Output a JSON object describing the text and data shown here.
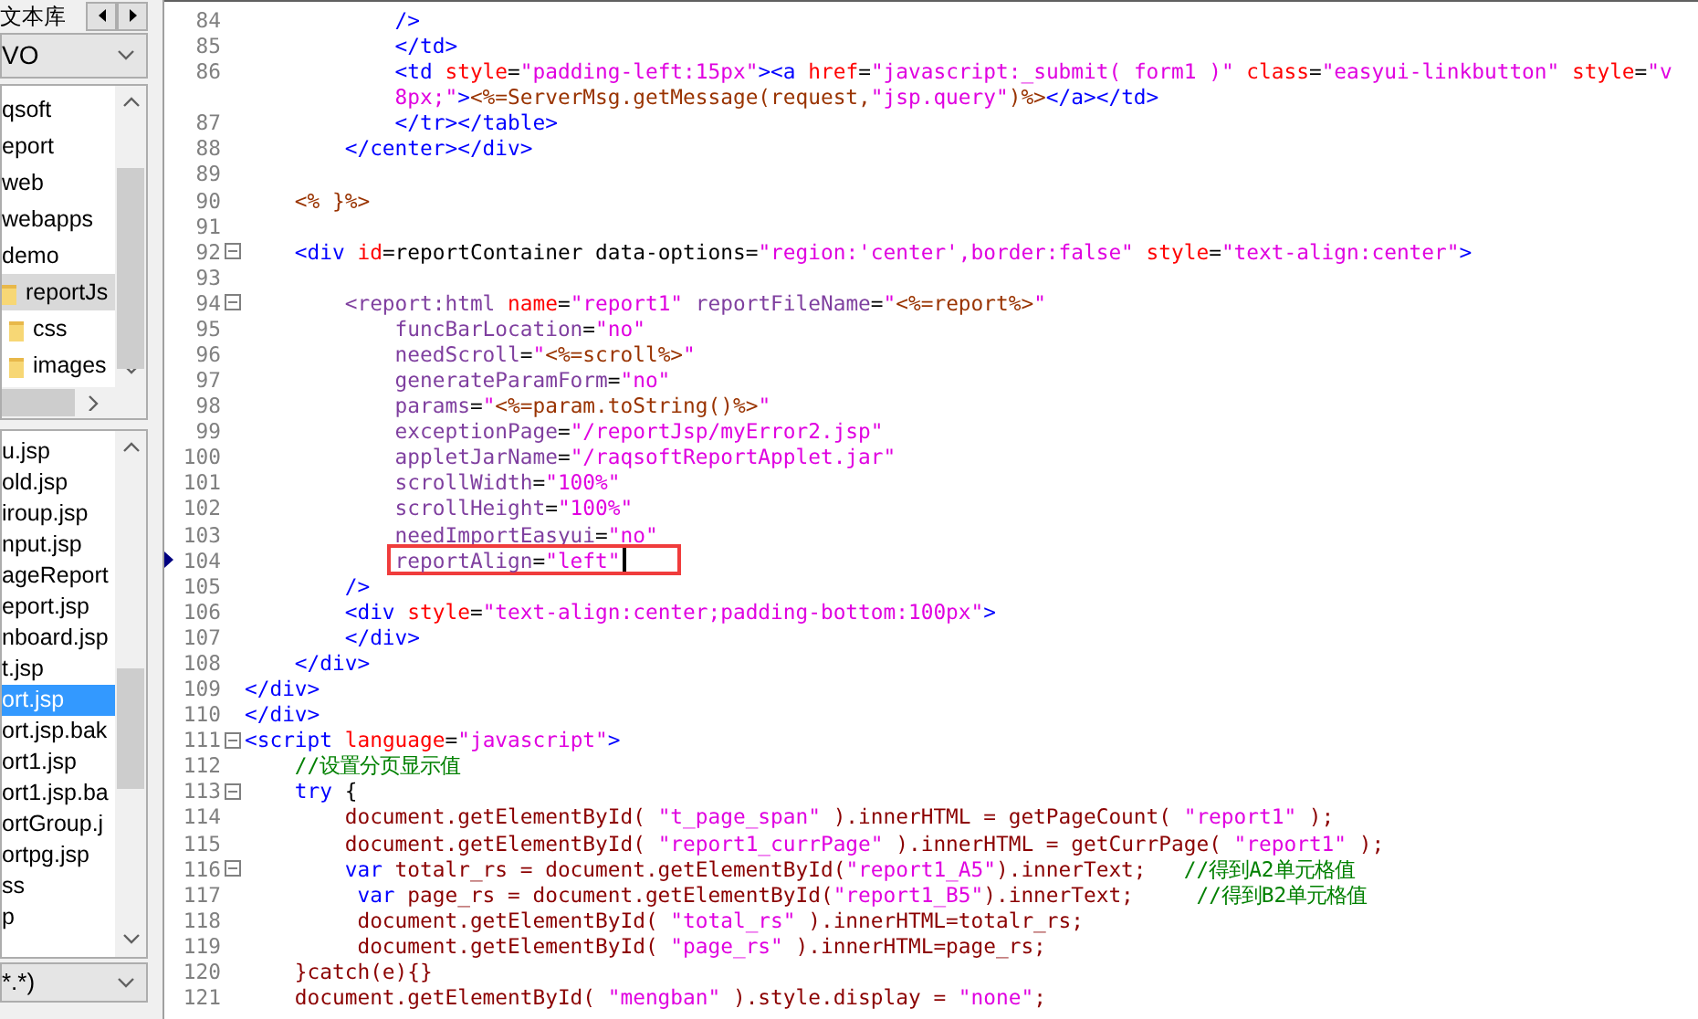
{
  "side_panel": {
    "tab_label": "文本库",
    "drive": "VO",
    "folders": [
      {
        "label": "qsoft",
        "kind": "plain",
        "selected": false
      },
      {
        "label": "eport",
        "kind": "plain",
        "selected": false
      },
      {
        "label": "web",
        "kind": "plain",
        "selected": false
      },
      {
        "label": "webapps",
        "kind": "plain",
        "selected": false
      },
      {
        "label": "demo",
        "kind": "plain",
        "selected": false
      },
      {
        "label": "reportJs",
        "kind": "folder",
        "selected": true,
        "children": [
          {
            "label": "css",
            "kind": "folder",
            "selected": false
          },
          {
            "label": "images",
            "kind": "folder",
            "selected": false
          }
        ]
      }
    ],
    "files": [
      {
        "label": "u.jsp",
        "selected": false
      },
      {
        "label": "old.jsp",
        "selected": false
      },
      {
        "label": "iroup.jsp",
        "selected": false
      },
      {
        "label": "nput.jsp",
        "selected": false
      },
      {
        "label": "ageReport",
        "selected": false
      },
      {
        "label": "eport.jsp",
        "selected": false
      },
      {
        "label": "nboard.jsp",
        "selected": false
      },
      {
        "label": "t.jsp",
        "selected": false
      },
      {
        "label": "ort.jsp",
        "selected": true
      },
      {
        "label": "ort.jsp.bak",
        "selected": false
      },
      {
        "label": "ort1.jsp",
        "selected": false
      },
      {
        "label": "ort1.jsp.ba",
        "selected": false
      },
      {
        "label": "ortGroup.j",
        "selected": false
      },
      {
        "label": "ortpg.jsp",
        "selected": false
      },
      {
        "label": "ss",
        "selected": false
      },
      {
        "label": "p",
        "selected": false
      }
    ],
    "filter": "*.*)"
  },
  "editor": {
    "lines": [
      {
        "number": "84",
        "fold": false,
        "segments": [
          {
            "kind": "tag",
            "text": "            />"
          }
        ]
      },
      {
        "number": "85",
        "fold": false,
        "segments": [
          {
            "kind": "tag",
            "text": "            </td>"
          }
        ]
      },
      {
        "number": "86",
        "fold": false,
        "segments": [
          {
            "kind": "tag",
            "text": "            <td"
          },
          {
            "kind": "attr",
            "text": " style"
          },
          {
            "kind": "plain",
            "text": "="
          },
          {
            "kind": "str",
            "text": "\"padding-left:15px\""
          },
          {
            "kind": "tag",
            "text": "><a"
          },
          {
            "kind": "attr",
            "text": " href"
          },
          {
            "kind": "plain",
            "text": "="
          },
          {
            "kind": "str",
            "text": "\"javascript:_submit( form1 )\""
          },
          {
            "kind": "attr",
            "text": " class"
          },
          {
            "kind": "plain",
            "text": "="
          },
          {
            "kind": "str",
            "text": "\"easyui-linkbutton\""
          },
          {
            "kind": "attr",
            "text": " style"
          },
          {
            "kind": "plain",
            "text": "="
          },
          {
            "kind": "str",
            "text": "\"v"
          }
        ]
      },
      {
        "fold": false,
        "segments": [
          {
            "kind": "str",
            "text": "            8px;\""
          },
          {
            "kind": "tag",
            "text": ">"
          },
          {
            "kind": "jsp",
            "text": "<%=ServerMsg.getMessage(request,"
          },
          {
            "kind": "str",
            "text": "\"jsp.query\""
          },
          {
            "kind": "jsp",
            "text": ")%>"
          },
          {
            "kind": "tag",
            "text": "</a></td>"
          }
        ]
      },
      {
        "number": "87",
        "fold": false,
        "segments": [
          {
            "kind": "tag",
            "text": "            </tr></table>"
          }
        ]
      },
      {
        "number": "88",
        "fold": false,
        "segments": [
          {
            "kind": "tag",
            "text": "        </center></div>"
          }
        ]
      },
      {
        "number": "89",
        "fold": false
      },
      {
        "number": "90",
        "fold": false,
        "segments": [
          {
            "kind": "jsp",
            "text": "    <% }%>"
          }
        ]
      },
      {
        "number": "91",
        "fold": false
      },
      {
        "number": "92",
        "fold": true,
        "segments": [
          {
            "kind": "tag",
            "text": "    <div"
          },
          {
            "kind": "attr",
            "text": " id"
          },
          {
            "kind": "plain",
            "text": "=reportContainer data-options="
          },
          {
            "kind": "str",
            "text": "\"region:'center',border:false\""
          },
          {
            "kind": "attr",
            "text": " style"
          },
          {
            "kind": "plain",
            "text": "="
          },
          {
            "kind": "str",
            "text": "\"text-align:center\""
          },
          {
            "kind": "tag",
            "text": ">"
          }
        ]
      },
      {
        "number": "93",
        "fold": false
      },
      {
        "number": "94",
        "fold": true,
        "segments": [
          {
            "kind": "ctag",
            "text": "        <report:html"
          },
          {
            "kind": "attr",
            "text": " name"
          },
          {
            "kind": "plain",
            "text": "="
          },
          {
            "kind": "str",
            "text": "\"report1\""
          },
          {
            "kind": "cattr",
            "text": " reportFileName"
          },
          {
            "kind": "plain",
            "text": "="
          },
          {
            "kind": "str",
            "text": "\""
          },
          {
            "kind": "jsp",
            "text": "<%=report%>"
          },
          {
            "kind": "str",
            "text": "\""
          }
        ]
      },
      {
        "number": "95",
        "fold": false,
        "segments": [
          {
            "kind": "cattr",
            "text": "            funcBarLocation"
          },
          {
            "kind": "plain",
            "text": "="
          },
          {
            "kind": "str",
            "text": "\"no\""
          }
        ]
      },
      {
        "number": "96",
        "fold": false,
        "segments": [
          {
            "kind": "cattr",
            "text": "            needScroll"
          },
          {
            "kind": "plain",
            "text": "="
          },
          {
            "kind": "str",
            "text": "\""
          },
          {
            "kind": "jsp",
            "text": "<%=scroll%>"
          },
          {
            "kind": "str",
            "text": "\""
          }
        ]
      },
      {
        "number": "97",
        "fold": false,
        "segments": [
          {
            "kind": "cattr",
            "text": "            generateParamForm"
          },
          {
            "kind": "plain",
            "text": "="
          },
          {
            "kind": "str",
            "text": "\"no\""
          }
        ]
      },
      {
        "number": "98",
        "fold": false,
        "segments": [
          {
            "kind": "cattr",
            "text": "            params"
          },
          {
            "kind": "plain",
            "text": "="
          },
          {
            "kind": "str",
            "text": "\""
          },
          {
            "kind": "jsp",
            "text": "<%=param.toString()%>"
          },
          {
            "kind": "str",
            "text": "\""
          }
        ]
      },
      {
        "number": "99",
        "fold": false,
        "segments": [
          {
            "kind": "cattr",
            "text": "            exceptionPage"
          },
          {
            "kind": "plain",
            "text": "="
          },
          {
            "kind": "str",
            "text": "\"/reportJsp/myError2.jsp\""
          }
        ]
      },
      {
        "number": "100",
        "fold": false,
        "segments": [
          {
            "kind": "cattr",
            "text": "            appletJarName"
          },
          {
            "kind": "plain",
            "text": "="
          },
          {
            "kind": "str",
            "text": "\"/raqsoftReportApplet.jar\""
          }
        ]
      },
      {
        "number": "101",
        "fold": false,
        "segments": [
          {
            "kind": "cattr",
            "text": "            scrollWidth"
          },
          {
            "kind": "plain",
            "text": "="
          },
          {
            "kind": "str",
            "text": "\"100%\""
          }
        ]
      },
      {
        "number": "102",
        "fold": false,
        "segments": [
          {
            "kind": "cattr",
            "text": "            scrollHeight"
          },
          {
            "kind": "plain",
            "text": "="
          },
          {
            "kind": "str",
            "text": "\"100%\""
          }
        ]
      },
      {
        "number": "103",
        "fold": false,
        "segments": [
          {
            "kind": "cattr",
            "text": "            needImportEasyui"
          },
          {
            "kind": "plain",
            "text": "="
          },
          {
            "kind": "str",
            "text": "\"no\""
          }
        ]
      },
      {
        "number": "104",
        "fold": false,
        "current": true,
        "highlight": true,
        "segments": [
          {
            "kind": "cattr",
            "text": "            reportAlign"
          },
          {
            "kind": "plain",
            "text": "="
          },
          {
            "kind": "str",
            "text": "\"left\""
          }
        ]
      },
      {
        "number": "105",
        "fold": false,
        "segments": [
          {
            "kind": "tag",
            "text": "        />"
          }
        ]
      },
      {
        "number": "106",
        "fold": false,
        "segments": [
          {
            "kind": "tag",
            "text": "        <div"
          },
          {
            "kind": "attr",
            "text": " style"
          },
          {
            "kind": "plain",
            "text": "="
          },
          {
            "kind": "str",
            "text": "\"text-align:center;padding-bottom:100px\""
          },
          {
            "kind": "tag",
            "text": ">"
          }
        ]
      },
      {
        "number": "107",
        "fold": false,
        "segments": [
          {
            "kind": "tag",
            "text": "        </div>"
          }
        ]
      },
      {
        "number": "108",
        "fold": false,
        "segments": [
          {
            "kind": "tag",
            "text": "    </div>"
          }
        ]
      },
      {
        "number": "109",
        "fold": false,
        "segments": [
          {
            "kind": "tag",
            "text": "</div>"
          }
        ]
      },
      {
        "number": "110",
        "fold": false,
        "segments": [
          {
            "kind": "tag",
            "text": "</div>"
          }
        ]
      },
      {
        "number": "111",
        "fold": true,
        "segments": [
          {
            "kind": "tag",
            "text": "<script"
          },
          {
            "kind": "attr",
            "text": " language"
          },
          {
            "kind": "plain",
            "text": "="
          },
          {
            "kind": "str",
            "text": "\"javascript\""
          },
          {
            "kind": "tag",
            "text": ">"
          }
        ]
      },
      {
        "number": "112",
        "fold": false,
        "segments": [
          {
            "kind": "comment",
            "text": "    //设置分页显示值"
          }
        ]
      },
      {
        "number": "113",
        "fold": true,
        "segments": [
          {
            "kind": "kw",
            "text": "    try"
          },
          {
            "kind": "plain",
            "text": " {"
          }
        ]
      },
      {
        "number": "114",
        "fold": false,
        "segments": [
          {
            "kind": "js",
            "text": "        document.getElementById( "
          },
          {
            "kind": "str",
            "text": "\"t_page_span\""
          },
          {
            "kind": "js",
            "text": " ).innerHTML = getPageCount( "
          },
          {
            "kind": "str",
            "text": "\"report1\""
          },
          {
            "kind": "js",
            "text": " );"
          }
        ]
      },
      {
        "number": "115",
        "fold": false,
        "segments": [
          {
            "kind": "js",
            "text": "        document.getElementById( "
          },
          {
            "kind": "str",
            "text": "\"report1_currPage\""
          },
          {
            "kind": "js",
            "text": " ).innerHTML = getCurrPage( "
          },
          {
            "kind": "str",
            "text": "\"report1\""
          },
          {
            "kind": "js",
            "text": " );"
          }
        ]
      },
      {
        "number": "116",
        "fold": true,
        "segments": [
          {
            "kind": "kw",
            "text": "        var"
          },
          {
            "kind": "js",
            "text": " totalr_rs = document.getElementById("
          },
          {
            "kind": "str",
            "text": "\"report1_A5\""
          },
          {
            "kind": "js",
            "text": ").innerText;   "
          },
          {
            "kind": "comment",
            "text": "//得到A2单元格值"
          }
        ]
      },
      {
        "number": "117",
        "fold": false,
        "segments": [
          {
            "kind": "kw",
            "text": "         var"
          },
          {
            "kind": "js",
            "text": " page_rs = document.getElementById("
          },
          {
            "kind": "str",
            "text": "\"report1_B5\""
          },
          {
            "kind": "js",
            "text": ").innerText;     "
          },
          {
            "kind": "comment",
            "text": "//得到B2单元格值"
          }
        ]
      },
      {
        "number": "118",
        "fold": false,
        "segments": [
          {
            "kind": "js",
            "text": "         document.getElementById( "
          },
          {
            "kind": "str",
            "text": "\"total_rs\""
          },
          {
            "kind": "js",
            "text": " ).innerHTML=totalr_rs;"
          }
        ]
      },
      {
        "number": "119",
        "fold": false,
        "segments": [
          {
            "kind": "js",
            "text": "         document.getElementById( "
          },
          {
            "kind": "str",
            "text": "\"page_rs\""
          },
          {
            "kind": "js",
            "text": " ).innerHTML=page_rs;"
          }
        ]
      },
      {
        "number": "120",
        "fold": false,
        "segments": [
          {
            "kind": "js",
            "text": "    }catch(e){}"
          }
        ]
      },
      {
        "number": "121",
        "fold": false,
        "segments": [
          {
            "kind": "js",
            "text": "    document.getElementById( "
          },
          {
            "kind": "str",
            "text": "\"mengban\""
          },
          {
            "kind": "js",
            "text": " ).style.display = "
          },
          {
            "kind": "str",
            "text": "\"none\""
          },
          {
            "kind": "js",
            "text": ";"
          }
        ]
      }
    ]
  }
}
